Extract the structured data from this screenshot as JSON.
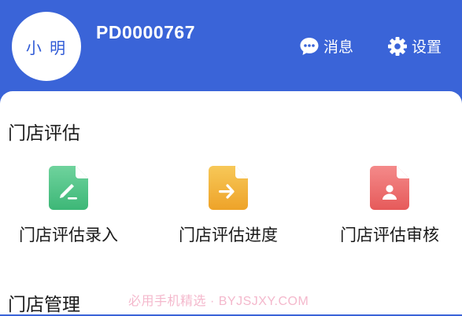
{
  "header": {
    "avatar_text": "小 明",
    "user_id": "PD0000767",
    "messages_label": "消息",
    "settings_label": "设置",
    "background_color": "#3a64d8"
  },
  "sections": [
    {
      "title": "门店评估",
      "items": [
        {
          "label": "门店评估录入",
          "icon": "edit-document-icon",
          "color": "#4fc48a"
        },
        {
          "label": "门店评估进度",
          "icon": "arrow-document-icon",
          "color": "#f0b23c"
        },
        {
          "label": "门店评估审核",
          "icon": "user-document-icon",
          "color": "#ec6a6a"
        }
      ]
    },
    {
      "title": "门店管理"
    }
  ],
  "watermark": "必用手机精选 · BYJSJXY.COM"
}
